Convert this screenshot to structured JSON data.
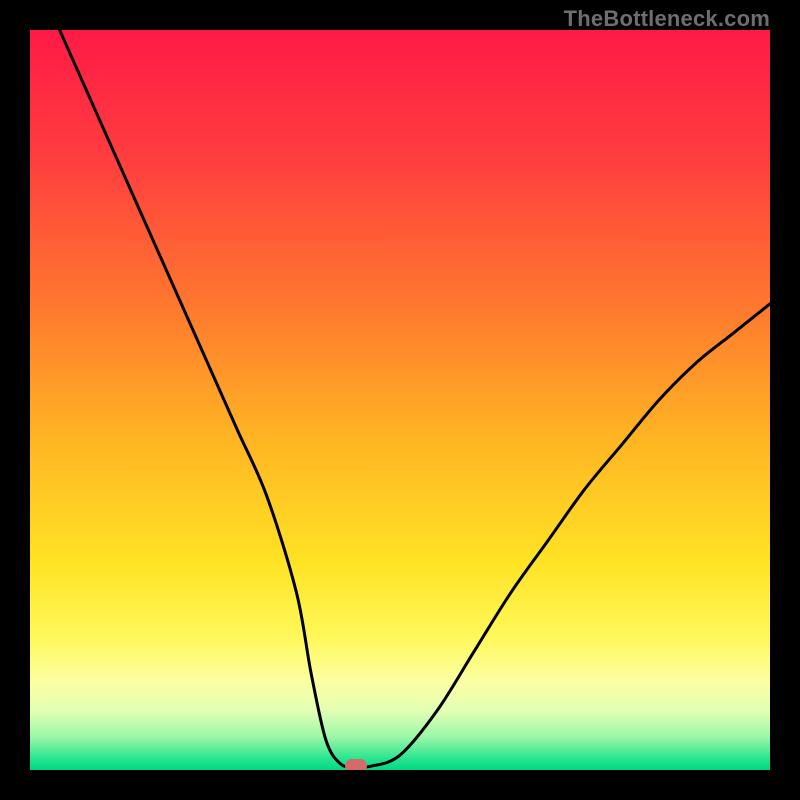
{
  "watermark": "TheBottleneck.com",
  "chart_data": {
    "type": "line",
    "title": "",
    "xlabel": "",
    "ylabel": "",
    "xlim": [
      0,
      100
    ],
    "ylim": [
      0,
      100
    ],
    "grid": false,
    "legend": false,
    "series": [
      {
        "name": "bottleneck-curve",
        "x": [
          4,
          8,
          12,
          16,
          20,
          24,
          28,
          32,
          36,
          38,
          40,
          42,
          44,
          46,
          50,
          55,
          60,
          65,
          70,
          75,
          80,
          85,
          90,
          95,
          100
        ],
        "y": [
          100,
          91,
          82,
          73,
          64,
          55,
          46,
          37,
          24,
          13,
          4,
          0.8,
          0.5,
          0.5,
          2,
          8,
          16,
          24,
          31,
          38,
          44,
          50,
          55,
          59,
          63
        ]
      }
    ],
    "minimum_marker": {
      "x": 44,
      "y": 0.6
    },
    "colors": {
      "gradient_stops": [
        {
          "offset": 0.0,
          "color": "#ff1a46"
        },
        {
          "offset": 0.18,
          "color": "#ff3f3e"
        },
        {
          "offset": 0.38,
          "color": "#ff7a2e"
        },
        {
          "offset": 0.55,
          "color": "#ffb423"
        },
        {
          "offset": 0.72,
          "color": "#ffe324"
        },
        {
          "offset": 0.82,
          "color": "#fff85a"
        },
        {
          "offset": 0.88,
          "color": "#fbffa2"
        },
        {
          "offset": 0.92,
          "color": "#e2ffb4"
        },
        {
          "offset": 0.955,
          "color": "#9cf7a8"
        },
        {
          "offset": 0.985,
          "color": "#28e58f"
        },
        {
          "offset": 1.0,
          "color": "#00d884"
        }
      ],
      "curve_stroke": "#000000",
      "marker_fill": "#d46a6a",
      "background": "#000000"
    }
  }
}
